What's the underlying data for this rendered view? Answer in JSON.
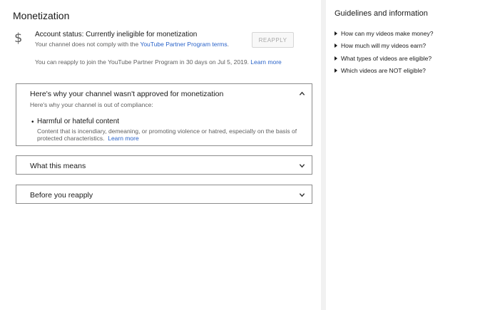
{
  "monetization": {
    "title": "Monetization",
    "status_title": "Account status: Currently ineligible for monetization",
    "status_sub_prefix": "Your channel does not comply with the ",
    "status_sub_link": "YouTube Partner Program terms",
    "status_sub_suffix": ".",
    "reapply_button": "REAPPLY",
    "reapply_note": "You can reapply to join the YouTube Partner Program in 30 days on Jul 5, 2019.",
    "reapply_learn_more": "Learn more"
  },
  "accordions": [
    {
      "title": "Here's why your channel wasn't approved for monetization",
      "subtitle": "Here's why your channel is out of compliance:",
      "expanded": true,
      "reason_title": "Harmful or hateful content",
      "reason_desc_line1": "Content that is incendiary, demeaning, or promoting violence or hatred, especially on the basis of",
      "reason_desc_line2": "protected characteristics.",
      "reason_learn_more": "Learn more"
    },
    {
      "title": "What this means",
      "expanded": false
    },
    {
      "title": "Before you reapply",
      "expanded": false
    }
  ],
  "guidelines": {
    "title": "Guidelines and information",
    "items": [
      "How can my videos make money?",
      "How much will my videos earn?",
      "What types of videos are eligible?",
      "Which videos are NOT eligible?"
    ]
  },
  "icons": {
    "status": "dollar-icon",
    "expanded": "chevron-up-icon",
    "collapsed": "chevron-down-icon",
    "bullet": "triangle-right-icon"
  },
  "colors": {
    "link": "#2a63c9",
    "background": "#f1f1f1",
    "panel": "#ffffff",
    "border": "#8c8c8c",
    "secondary_text": "#606060"
  }
}
